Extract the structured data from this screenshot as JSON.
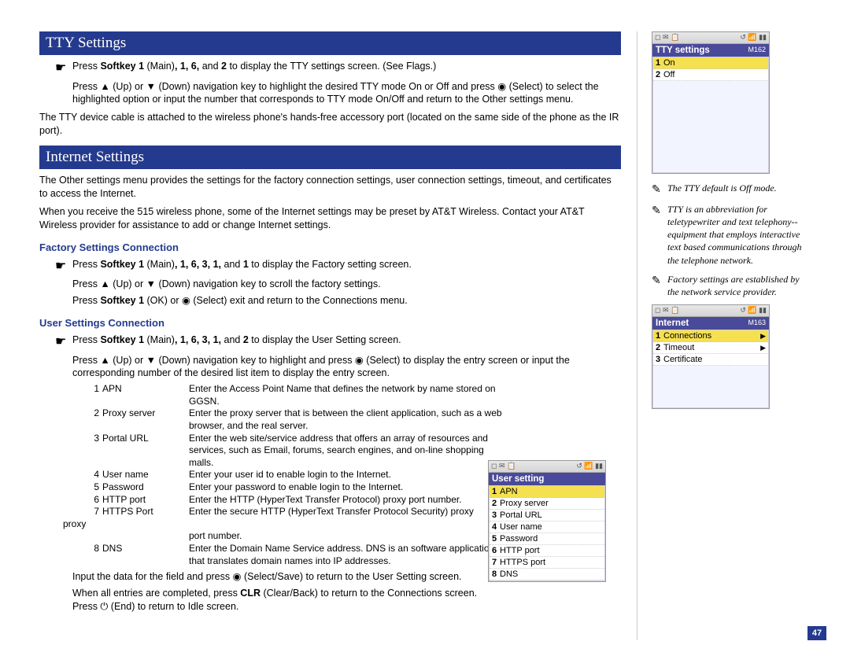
{
  "page_number": "47",
  "sections": {
    "tty": {
      "title": "TTY Settings",
      "step1_pre": "Press ",
      "step1_bold1": "Softkey 1",
      "step1_mid1": " (Main)",
      "step1_bold2": ", 1, 6,",
      "step1_mid2": " and ",
      "step1_bold3": "2",
      "step1_post": " to display the TTY settings screen. (See Flags.)",
      "step2": "Press ▲ (Up) or ▼ (Down) navigation key to highlight the desired TTY mode On or Off and press ◉ (Select) to select the highlighted option or input the number that corresponds to TTY mode On/Off and return to the Other settings menu.",
      "body": "The TTY device cable is attached to the wireless phone's hands-free accessory port (located on the same side of the phone as the IR port)."
    },
    "internet": {
      "title": "Internet Settings",
      "body1": "The Other settings menu provides the settings for the factory connection settings, user connection settings, timeout, and certificates to access the Internet.",
      "body2": "When you receive the 515 wireless phone, some of the Internet settings may be preset by AT&T Wireless. Contact your AT&T Wireless provider for assistance to add or change Internet settings.",
      "factory": {
        "head": "Factory Settings Connection",
        "s1_pre": "Press ",
        "s1_b1": "Softkey 1",
        "s1_m1": " (Main)",
        "s1_b2": ", 1, 6, 3, 1,",
        "s1_m2": " and ",
        "s1_b3": "1",
        "s1_post": " to display the Factory setting screen.",
        "s2": "Press ▲ (Up) or ▼ (Down) navigation key to scroll the factory settings.",
        "s3_pre": "Press ",
        "s3_b1": "Softkey 1",
        "s3_mid": " (OK) or ◉ (Select) exit and return to the Connections menu."
      },
      "user": {
        "head": "User Settings Connection",
        "s1_pre": "Press ",
        "s1_b1": "Softkey 1",
        "s1_m1": " (Main)",
        "s1_b2": ", 1, 6, 3, 1,",
        "s1_m2": " and ",
        "s1_b3": "2",
        "s1_post": " to display the User Setting screen.",
        "s2": "Press ▲ (Up) or ▼ (Down) navigation key to highlight and press ◉ (Select) to display the entry screen or input the corresponding number of the desired list item to display the entry screen.",
        "list": [
          {
            "n": "1",
            "label": "APN",
            "desc": "Enter the Access Point Name that defines the network by name stored on GGSN."
          },
          {
            "n": "2",
            "label": "Proxy server",
            "desc": "Enter the proxy server that is between the client application, such as a web browser, and the real server."
          },
          {
            "n": "3",
            "label": "Portal URL",
            "desc": "Enter the web site/service address that offers an array of resources and services, such as Email, forums, search engines, and on-line shopping malls."
          },
          {
            "n": "4",
            "label": "User name",
            "desc": "Enter your user id to enable login to the Internet."
          },
          {
            "n": "5",
            "label": "Password",
            "desc": "Enter your password to enable login to the Internet."
          },
          {
            "n": "6",
            "label": "HTTP port",
            "desc": "Enter the HTTP (HyperText Transfer Protocol) proxy port number."
          },
          {
            "n": "7",
            "label": "HTTPS Port",
            "desc": "Enter the secure HTTP (HyperText Transfer Protocol Security) proxy"
          }
        ],
        "list_extra_left": "proxy",
        "list_extra_right": "port number.",
        "list8_n": "8",
        "list8_label": "DNS",
        "list8_desc": "Enter the Domain Name Service address. DNS is an software application that translates domain names into IP addresses.",
        "s3": "Input the data for the field and press ◉ (Select/Save) to return to the User Setting screen.",
        "s4_pre": "When all entries are completed, press ",
        "s4_b1": "CLR",
        "s4_mid": " (Clear/Back) to return to the Connections screen. Press ⏻ (End) to return to Idle screen."
      }
    }
  },
  "side_notes": [
    "The TTY default is Off mode.",
    "TTY is an abbreviation for teletypewriter and text telephony--equipment that employs interactive text based communications through the telephone network.",
    "Factory settings are established by the network service provider."
  ],
  "screens": {
    "tty": {
      "title": "TTY settings",
      "code": "M162",
      "rows": [
        {
          "n": "1",
          "label": "On",
          "sel": true
        },
        {
          "n": "2",
          "label": "Off",
          "sel": false
        }
      ]
    },
    "internet": {
      "title": "Internet",
      "code": "M163",
      "rows": [
        {
          "n": "1",
          "label": "Connections",
          "sel": true,
          "arrow": true
        },
        {
          "n": "2",
          "label": "Timeout",
          "sel": false,
          "arrow": true
        },
        {
          "n": "3",
          "label": "Certificate",
          "sel": false,
          "arrow": false
        }
      ]
    },
    "user": {
      "title": "User setting",
      "code": "",
      "rows": [
        {
          "n": "1",
          "label": "APN",
          "sel": true
        },
        {
          "n": "2",
          "label": "Proxy server"
        },
        {
          "n": "3",
          "label": "Portal URL"
        },
        {
          "n": "4",
          "label": "User name"
        },
        {
          "n": "5",
          "label": "Password"
        },
        {
          "n": "6",
          "label": "HTTP port"
        },
        {
          "n": "7",
          "label": "HTTPS port"
        },
        {
          "n": "8",
          "label": "DNS"
        }
      ]
    }
  }
}
